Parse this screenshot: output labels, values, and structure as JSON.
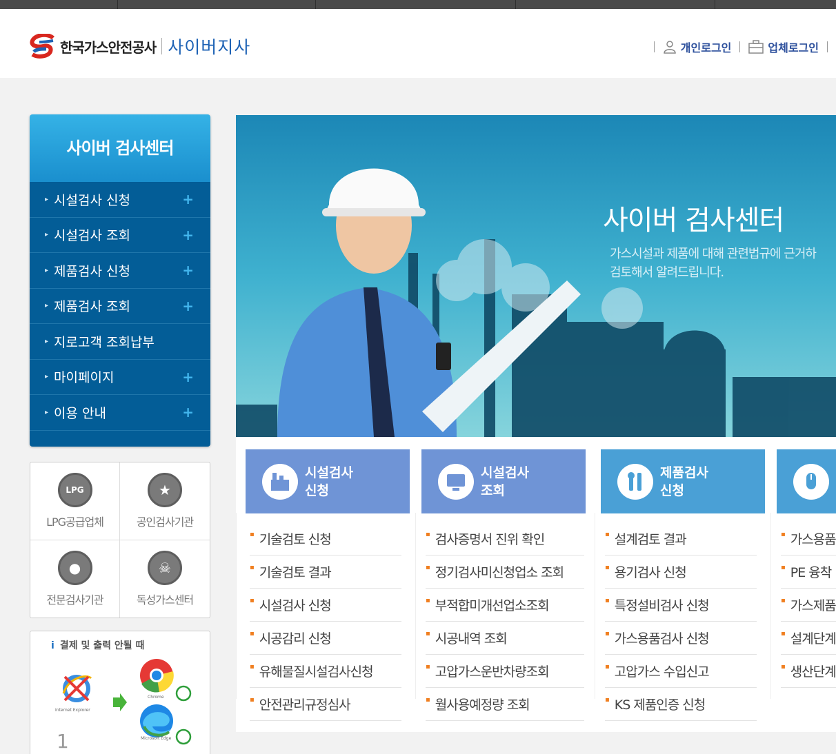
{
  "header": {
    "logo_text": "한국가스안전공사",
    "logo_sub": "사이버지사",
    "login_personal": "개인로그인",
    "login_company": "업체로그인"
  },
  "lnb": {
    "title": "사이버 검사센터",
    "items": [
      {
        "label": "시설검사 신청",
        "plus": "+"
      },
      {
        "label": "시설검사 조회",
        "plus": "+"
      },
      {
        "label": "제품검사 신청",
        "plus": "+"
      },
      {
        "label": "제품검사 조회",
        "plus": "+"
      },
      {
        "label": "지로고객 조회납부",
        "plus": ""
      },
      {
        "label": "마이페이지",
        "plus": "+"
      },
      {
        "label": "이용 안내",
        "plus": "+"
      }
    ]
  },
  "quick": [
    {
      "label": "LPG공급업체",
      "icon_text": "LPG"
    },
    {
      "label": "공인검사기관",
      "icon_text": "★"
    },
    {
      "label": "전문검사기관",
      "icon_text": "●"
    },
    {
      "label": "독성가스센터",
      "icon_text": "☠"
    }
  ],
  "notice": {
    "title": "결제 및 출력 안될 때",
    "step": "1",
    "ie_label": "Internet Explorer",
    "chrome_label": "Chrome",
    "edge_label": "Microsoft Edge"
  },
  "visual": {
    "title": "사이버 검사센터",
    "desc_line1": "가스시설과 제품에 대해 관련법규에 근거하",
    "desc_line2": "검토해서 알려드립니다."
  },
  "categories": [
    {
      "line1": "시설검사",
      "line2": "신청",
      "color": "#6f94d6",
      "items": [
        "기술검토 신청",
        "기술검토 결과",
        "시설검사 신청",
        "시공감리 신청",
        "유해물질시설검사신청",
        "안전관리규정심사"
      ]
    },
    {
      "line1": "시설검사",
      "line2": "조회",
      "color": "#6f94d6",
      "items": [
        "검사증명서 진위 확인",
        "정기검사미신청업소 조회",
        "부적합미개선업소조회",
        "시공내역 조회",
        "고압가스운반차량조회",
        "월사용예정량 조회"
      ]
    },
    {
      "line1": "제품검사",
      "line2": "신청",
      "color": "#4aa0d6",
      "items": [
        "설계검토 결과",
        "용기검사 신청",
        "특정설비검사 신청",
        "가스용품검사 신청",
        "고압가스 수입신고",
        "KS 제품인증 신청"
      ]
    },
    {
      "line1": "",
      "line2": "",
      "color": "#4aa0d6",
      "items": [
        "가스용품",
        "PE 융착",
        "가스제품",
        "설계단계",
        "생산단계"
      ]
    }
  ]
}
